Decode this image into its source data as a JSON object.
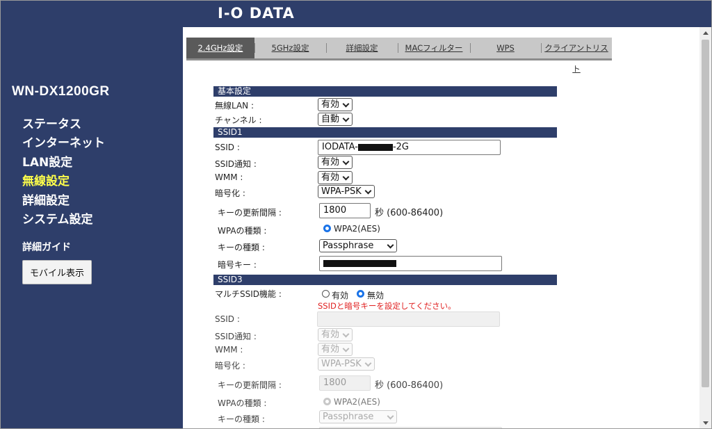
{
  "colors": {
    "sidebar_bg": "#2e3e6a",
    "active_nav": "#ffff4a",
    "warning": "#e02020",
    "radio_on": "#1a73e8"
  },
  "brand": {
    "logo_text": "I-O DATA"
  },
  "sidebar": {
    "model": "WN-DX1200GR",
    "nav": [
      {
        "label": "ステータス",
        "active": false
      },
      {
        "label": "インターネット",
        "active": false
      },
      {
        "label": "LAN設定",
        "active": false
      },
      {
        "label": "無線設定",
        "active": true
      },
      {
        "label": "詳細設定",
        "active": false
      },
      {
        "label": "システム設定",
        "active": false
      }
    ],
    "guide": "詳細ガイド",
    "mobile_button": "モバイル表示"
  },
  "tabs": [
    {
      "label": "2.4GHz設定",
      "active": true
    },
    {
      "label": "5GHz設定",
      "active": false
    },
    {
      "label": "詳細設定",
      "active": false
    },
    {
      "label": "MACフィルター",
      "active": false
    },
    {
      "label": "WPS",
      "active": false
    },
    {
      "label": "クライアントリスト",
      "active": false
    }
  ],
  "basic": {
    "header": "基本設定",
    "wireless_lan": {
      "label": "無線LAN :",
      "value": "有効"
    },
    "channel": {
      "label": "チャンネル :",
      "value": "自動"
    }
  },
  "ssid1": {
    "header": "SSID1",
    "ssid": {
      "label": "SSID :",
      "prefix": "IODATA-",
      "suffix": "-2G"
    },
    "ssid_notify": {
      "label": "SSID通知 :",
      "value": "有効"
    },
    "wmm": {
      "label": "WMM :",
      "value": "有効"
    },
    "encryption": {
      "label": "暗号化 :",
      "value": "WPA-PSK"
    },
    "key_interval": {
      "label": "キーの更新間隔 :",
      "value": "1800",
      "unit": "秒 (600-86400)"
    },
    "wpa_type": {
      "label": "WPAの種類 :",
      "option": "WPA2(AES)"
    },
    "key_type": {
      "label": "キーの種類 :",
      "value": "Passphrase"
    },
    "passkey": {
      "label": "暗号キー :"
    }
  },
  "ssid3": {
    "header": "SSID3",
    "multi_ssid": {
      "label": "マルチSSID機能 :",
      "options": [
        "有効",
        "無効"
      ],
      "selected": "無効"
    },
    "warning": "SSIDと暗号キーを設定してください。",
    "ssid": {
      "label": "SSID :",
      "value": ""
    },
    "ssid_notify": {
      "label": "SSID通知 :",
      "value": "有効"
    },
    "wmm": {
      "label": "WMM :",
      "value": "有効"
    },
    "encryption": {
      "label": "暗号化 :",
      "value": "WPA-PSK"
    },
    "key_interval": {
      "label": "キーの更新間隔 :",
      "value": "1800",
      "unit": "秒 (600-86400)"
    },
    "wpa_type": {
      "label": "WPAの種類 :",
      "option": "WPA2(AES)"
    },
    "key_type": {
      "label": "キーの種類 :",
      "value": "Passphrase"
    }
  }
}
